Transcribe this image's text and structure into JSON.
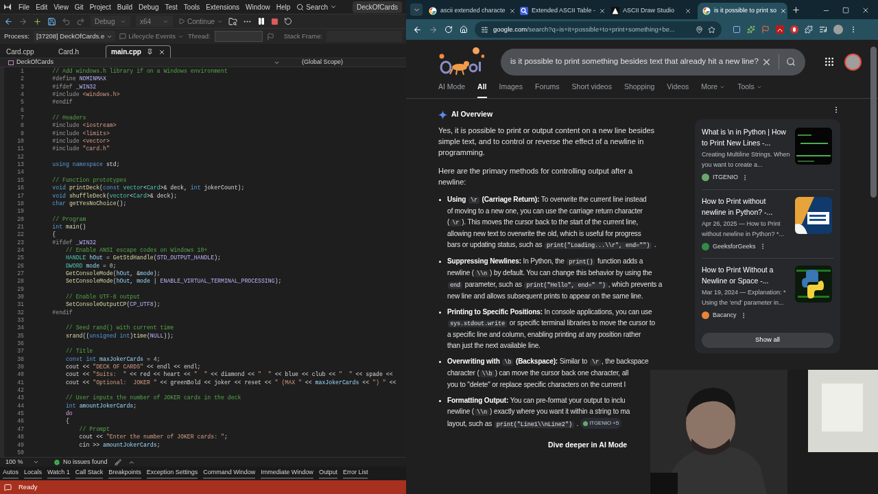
{
  "vs": {
    "menu": [
      "File",
      "Edit",
      "View",
      "Git",
      "Project",
      "Build",
      "Debug",
      "Test",
      "Tools",
      "Extensions",
      "Window",
      "Help"
    ],
    "search": "Search",
    "solution": "DeckOfCards",
    "toolbar": {
      "config": "Debug",
      "platform": "x64",
      "continue": "Continue"
    },
    "debug_bar": {
      "process_label": "Process:",
      "process": "[37208] DeckOfCards.e",
      "lifecycle": "Lifecycle Events",
      "thread_label": "Thread:",
      "stack_label": "Stack Frame:"
    },
    "doc_tabs": [
      {
        "label": "Card.cpp",
        "selected": false
      },
      {
        "label": "Card.h",
        "selected": false
      },
      {
        "label": "main.cpp",
        "selected": true
      }
    ],
    "nav": {
      "project": "DeckOfCards",
      "scope": "(Global Scope)"
    },
    "code": [
      {
        "n": "1",
        "t": [
          {
            "kind": "comment",
            "text": "        // Add windows.h library if on a Windows environment"
          }
        ]
      },
      {
        "n": "2",
        "t": [
          {
            "kind": "preproc",
            "text": "        #define "
          },
          {
            "kind": "macro",
            "text": "NOMINMAX"
          }
        ]
      },
      {
        "n": "3",
        "t": [
          {
            "kind": "preproc",
            "text": "        #ifdef "
          },
          {
            "kind": "macro",
            "text": "_WIN32"
          }
        ]
      },
      {
        "n": "4",
        "t": [
          {
            "kind": "preproc",
            "text": "        #include "
          },
          {
            "kind": "string",
            "text": "<windows.h>"
          }
        ]
      },
      {
        "n": "5",
        "t": [
          {
            "kind": "preproc",
            "text": "        #endif"
          }
        ]
      },
      {
        "n": "6"
      },
      {
        "n": "7",
        "t": [
          {
            "kind": "comment",
            "text": "        // Headers"
          }
        ]
      },
      {
        "n": "8",
        "t": [
          {
            "kind": "preproc",
            "text": "        #include "
          },
          {
            "kind": "string",
            "text": "<iostream>"
          }
        ]
      },
      {
        "n": "9",
        "t": [
          {
            "kind": "preproc",
            "text": "        #include "
          },
          {
            "kind": "string",
            "text": "<limits>"
          }
        ]
      },
      {
        "n": "10",
        "t": [
          {
            "kind": "preproc",
            "text": "        #include "
          },
          {
            "kind": "string",
            "text": "<vector>"
          }
        ]
      },
      {
        "n": "11",
        "t": [
          {
            "kind": "preproc",
            "text": "        #include "
          },
          {
            "kind": "string",
            "text": "\"card.h\""
          }
        ]
      },
      {
        "n": "12"
      },
      {
        "n": "13",
        "t": [
          {
            "kind": "keyword",
            "text": "        using namespace"
          },
          {
            "kind": "plain",
            "text": " std;"
          }
        ]
      },
      {
        "n": "14"
      },
      {
        "n": "15",
        "t": [
          {
            "kind": "comment",
            "text": "        // Function prototypes"
          }
        ]
      },
      {
        "n": "16",
        "t": [
          {
            "kind": "keyword",
            "text": "        void "
          },
          {
            "kind": "function",
            "text": "printDeck"
          },
          {
            "kind": "plain",
            "text": "("
          },
          {
            "kind": "keyword",
            "text": "const "
          },
          {
            "kind": "type",
            "text": "vector"
          },
          {
            "kind": "plain",
            "text": "<"
          },
          {
            "kind": "type",
            "text": "Card"
          },
          {
            "kind": "plain",
            "text": ">& deck, "
          },
          {
            "kind": "keyword",
            "text": "int"
          },
          {
            "kind": "plain",
            "text": " jokerCount);"
          }
        ]
      },
      {
        "n": "17",
        "t": [
          {
            "kind": "keyword",
            "text": "        void "
          },
          {
            "kind": "function",
            "text": "shuffleDeck"
          },
          {
            "kind": "plain",
            "text": "("
          },
          {
            "kind": "type",
            "text": "vector"
          },
          {
            "kind": "plain",
            "text": "<"
          },
          {
            "kind": "type",
            "text": "Card"
          },
          {
            "kind": "plain",
            "text": ">& deck);"
          }
        ]
      },
      {
        "n": "18",
        "t": [
          {
            "kind": "keyword",
            "text": "        char "
          },
          {
            "kind": "function",
            "text": "getYesNoChoice"
          },
          {
            "kind": "plain",
            "text": "();"
          }
        ]
      },
      {
        "n": "19"
      },
      {
        "n": "20",
        "t": [
          {
            "kind": "comment",
            "text": "        // Program"
          }
        ]
      },
      {
        "n": "21",
        "t": [
          {
            "kind": "keyword",
            "text": "        int "
          },
          {
            "kind": "function",
            "text": "main"
          },
          {
            "kind": "plain",
            "text": "()"
          }
        ]
      },
      {
        "n": "22",
        "t": [
          {
            "kind": "plain",
            "text": "        {"
          }
        ]
      },
      {
        "n": "23",
        "t": [
          {
            "kind": "preproc",
            "text": "        #ifdef "
          },
          {
            "kind": "macro",
            "text": "_WIN32"
          }
        ]
      },
      {
        "n": "24",
        "t": [
          {
            "kind": "comment",
            "text": "            // Enable ANSI escape codes on Windows 10+"
          }
        ]
      },
      {
        "n": "25",
        "t": [
          {
            "kind": "type",
            "text": "            HANDLE "
          },
          {
            "kind": "variable",
            "text": "hOut"
          },
          {
            "kind": "plain",
            "text": " = "
          },
          {
            "kind": "function",
            "text": "GetStdHandle"
          },
          {
            "kind": "plain",
            "text": "("
          },
          {
            "kind": "macro",
            "text": "STD_OUTPUT_HANDLE"
          },
          {
            "kind": "plain",
            "text": ");"
          }
        ]
      },
      {
        "n": "26",
        "t": [
          {
            "kind": "type",
            "text": "            DWORD "
          },
          {
            "kind": "variable",
            "text": "mode"
          },
          {
            "kind": "plain",
            "text": " = "
          },
          {
            "kind": "number",
            "text": "0"
          },
          {
            "kind": "plain",
            "text": ";"
          }
        ]
      },
      {
        "n": "27",
        "t": [
          {
            "kind": "function",
            "text": "            GetConsoleMode"
          },
          {
            "kind": "plain",
            "text": "("
          },
          {
            "kind": "variable",
            "text": "hOut"
          },
          {
            "kind": "plain",
            "text": ", &"
          },
          {
            "kind": "variable",
            "text": "mode"
          },
          {
            "kind": "plain",
            "text": ");"
          }
        ]
      },
      {
        "n": "28",
        "t": [
          {
            "kind": "function",
            "text": "            SetConsoleMode"
          },
          {
            "kind": "plain",
            "text": "("
          },
          {
            "kind": "variable",
            "text": "hOut"
          },
          {
            "kind": "plain",
            "text": ", "
          },
          {
            "kind": "variable",
            "text": "mode"
          },
          {
            "kind": "plain",
            "text": " | "
          },
          {
            "kind": "macro",
            "text": "ENABLE_VIRTUAL_TERMINAL_PROCESSING"
          },
          {
            "kind": "plain",
            "text": ");"
          }
        ]
      },
      {
        "n": "29"
      },
      {
        "n": "30",
        "t": [
          {
            "kind": "comment",
            "text": "            // Enable UTF-8 output"
          }
        ]
      },
      {
        "n": "31",
        "t": [
          {
            "kind": "function",
            "text": "            SetConsoleOutputCP"
          },
          {
            "kind": "plain",
            "text": "("
          },
          {
            "kind": "macro",
            "text": "CP_UTF8"
          },
          {
            "kind": "plain",
            "text": ");"
          }
        ]
      },
      {
        "n": "32",
        "t": [
          {
            "kind": "preproc",
            "text": "        #endif"
          }
        ]
      },
      {
        "n": "33"
      },
      {
        "n": "34",
        "t": [
          {
            "kind": "comment",
            "text": "            // Seed rand() with current time"
          }
        ]
      },
      {
        "n": "35",
        "t": [
          {
            "kind": "function",
            "text": "            srand"
          },
          {
            "kind": "plain",
            "text": "(("
          },
          {
            "kind": "keyword",
            "text": "unsigned int"
          },
          {
            "kind": "plain",
            "text": ")"
          },
          {
            "kind": "function",
            "text": "time"
          },
          {
            "kind": "plain",
            "text": "("
          },
          {
            "kind": "macro",
            "text": "NULL"
          },
          {
            "kind": "plain",
            "text": "));"
          }
        ]
      },
      {
        "n": "36"
      },
      {
        "n": "37",
        "t": [
          {
            "kind": "comment",
            "text": "            // Title"
          }
        ]
      },
      {
        "n": "38",
        "t": [
          {
            "kind": "keyword",
            "text": "            const int "
          },
          {
            "kind": "variable",
            "text": "maxJokerCards"
          },
          {
            "kind": "plain",
            "text": " = "
          },
          {
            "kind": "number",
            "text": "4"
          },
          {
            "kind": "plain",
            "text": ";"
          }
        ]
      },
      {
        "n": "39",
        "t": [
          {
            "kind": "plain",
            "text": "            cout << "
          },
          {
            "kind": "string",
            "text": "\"DECK OF CARDS\""
          },
          {
            "kind": "plain",
            "text": " << endl << endl;"
          }
        ]
      },
      {
        "n": "40",
        "t": [
          {
            "kind": "plain",
            "text": "            cout << "
          },
          {
            "kind": "string",
            "text": "\"Suits:  \""
          },
          {
            "kind": "plain",
            "text": " << red << heart << "
          },
          {
            "kind": "string",
            "text": "\"  \""
          },
          {
            "kind": "plain",
            "text": " << diamond << "
          },
          {
            "kind": "string",
            "text": "\"  \""
          },
          {
            "kind": "plain",
            "text": " << blue << club << "
          },
          {
            "kind": "string",
            "text": "\"  \""
          },
          {
            "kind": "plain",
            "text": " << spade <<"
          }
        ]
      },
      {
        "n": "41",
        "t": [
          {
            "kind": "plain",
            "text": "            cout << "
          },
          {
            "kind": "string",
            "text": "\"Optional:  JOKER \""
          },
          {
            "kind": "plain",
            "text": " << greenBold << joker << reset << "
          },
          {
            "kind": "string",
            "text": "\" (MAX \""
          },
          {
            "kind": "plain",
            "text": " << "
          },
          {
            "kind": "variable",
            "text": "maxJokerCards"
          },
          {
            "kind": "plain",
            "text": " << "
          },
          {
            "kind": "string",
            "text": "\") \""
          },
          {
            "kind": "plain",
            "text": " <<"
          }
        ]
      },
      {
        "n": "42"
      },
      {
        "n": "43",
        "t": [
          {
            "kind": "comment",
            "text": "            // User inputs the number of JOKER cards in the deck"
          }
        ]
      },
      {
        "n": "44",
        "t": [
          {
            "kind": "keyword",
            "text": "            int "
          },
          {
            "kind": "variable",
            "text": "amountJokerCards"
          },
          {
            "kind": "plain",
            "text": ";"
          }
        ]
      },
      {
        "n": "45",
        "t": [
          {
            "kind": "control",
            "text": "            do"
          }
        ]
      },
      {
        "n": "46",
        "t": [
          {
            "kind": "plain",
            "text": "            {"
          }
        ]
      },
      {
        "n": "47",
        "t": [
          {
            "kind": "comment",
            "text": "                // Prompt"
          }
        ]
      },
      {
        "n": "48",
        "t": [
          {
            "kind": "plain",
            "text": "                cout << "
          },
          {
            "kind": "string",
            "text": "\"Enter the number of JOKER cards: \""
          },
          {
            "kind": "plain",
            "text": ";"
          }
        ]
      },
      {
        "n": "49",
        "t": [
          {
            "kind": "plain",
            "text": "                cin >> "
          },
          {
            "kind": "variable",
            "text": "amountJokerCards"
          },
          {
            "kind": "plain",
            "text": ";"
          }
        ]
      },
      {
        "n": "50"
      }
    ],
    "editor_status": {
      "zoom": "100 %",
      "issues": "No issues found"
    },
    "tool_tabs": [
      "Autos",
      "Locals",
      "Watch 1",
      "Call Stack",
      "Breakpoints",
      "Exception Settings",
      "Command Window",
      "Immediate Window",
      "Output",
      "Error List"
    ],
    "status": "Ready"
  },
  "browser": {
    "tabs": [
      {
        "title": "ascii extended characte",
        "kind": "google",
        "selected": false
      },
      {
        "title": "Extended ASCII Table -",
        "kind": "magnifier",
        "selected": false
      },
      {
        "title": "ASCII Draw Studio",
        "kind": "triangle",
        "selected": false
      },
      {
        "title": "is it possible to print so",
        "kind": "google",
        "selected": true
      }
    ],
    "url_host": "google.com",
    "url_path": "/search?q=is+it+possible+to+print+something+be...",
    "query": "is it possible to print something besides text that already hit a new line?",
    "nav": [
      {
        "label": "AI Mode",
        "selected": false
      },
      {
        "label": "All",
        "selected": true
      },
      {
        "label": "Images",
        "selected": false
      },
      {
        "label": "Forums",
        "selected": false
      },
      {
        "label": "Short videos",
        "selected": false
      },
      {
        "label": "Shopping",
        "selected": false
      },
      {
        "label": "Videos",
        "selected": false
      },
      {
        "label": "More",
        "selected": false
      },
      {
        "label": "Tools",
        "selected": false
      }
    ],
    "ai": {
      "heading": "AI Overview",
      "intro": "Yes, it is possible to print or output content on a new line besides simple text, and to control or reverse the effect of a newline in programming.",
      "lead": "Here are the primary methods for controlling output after a newline:",
      "bullets": [
        {
          "lines": [
            [
              {
                "kind": "bold",
                "text": "Using "
              },
              {
                "kind": "code",
                "text": "\\r"
              },
              {
                "kind": "bold",
                "text": " (Carriage Return):"
              },
              {
                "kind": "plain",
                "text": " To overwrite the current line instead"
              }
            ],
            [
              {
                "kind": "plain",
                "text": "of moving to a new one, you can use the carriage return character"
              }
            ],
            [
              {
                "kind": "plain",
                "text": "("
              },
              {
                "kind": "code",
                "text": "\\r"
              },
              {
                "kind": "plain",
                "text": "). This moves the cursor back to the start of the current line,"
              }
            ],
            [
              {
                "kind": "plain",
                "text": "allowing new text to overwrite the old, which is useful for progress"
              }
            ],
            [
              {
                "kind": "plain",
                "text": "bars or updating status, such as "
              },
              {
                "kind": "code",
                "text": "print(\"Loading...\\\\r\", end=\"\")"
              },
              {
                "kind": "plain",
                "text": " ."
              }
            ]
          ]
        },
        {
          "lines": [
            [
              {
                "kind": "bold",
                "text": "Suppressing Newlines:"
              },
              {
                "kind": "plain",
                "text": " In Python, the "
              },
              {
                "kind": "code",
                "text": "print()"
              },
              {
                "kind": "plain",
                "text": " function adds a"
              }
            ],
            [
              {
                "kind": "plain",
                "text": "newline ("
              },
              {
                "kind": "code",
                "text": "\\\\n"
              },
              {
                "kind": "plain",
                "text": ") by default. You can change this behavior by using the"
              }
            ],
            [
              {
                "kind": "code",
                "text": "end"
              },
              {
                "kind": "plain",
                "text": " parameter, such as "
              },
              {
                "kind": "code",
                "text": "print(\"Hello\", end=\" \")"
              },
              {
                "kind": "plain",
                "text": ", which prevents a"
              }
            ],
            [
              {
                "kind": "plain",
                "text": "new line and allows subsequent prints to appear on the same line."
              }
            ]
          ]
        },
        {
          "lines": [
            [
              {
                "kind": "bold",
                "text": "Printing to Specific Positions:"
              },
              {
                "kind": "plain",
                "text": " In console applications, you can use"
              }
            ],
            [
              {
                "kind": "code",
                "text": "sys.stdout.write"
              },
              {
                "kind": "plain",
                "text": " or specific terminal libraries to move the cursor to"
              }
            ],
            [
              {
                "kind": "plain",
                "text": "a specific line and column, enabling printing at any position rather"
              }
            ],
            [
              {
                "kind": "plain",
                "text": "than just the next available line."
              }
            ]
          ]
        },
        {
          "lines": [
            [
              {
                "kind": "bold",
                "text": "Overwriting with "
              },
              {
                "kind": "code",
                "text": "\\b"
              },
              {
                "kind": "bold",
                "text": " (Backspace):"
              },
              {
                "kind": "plain",
                "text": " Similar to "
              },
              {
                "kind": "code",
                "text": "\\r"
              },
              {
                "kind": "plain",
                "text": ", the backspace"
              }
            ],
            [
              {
                "kind": "plain",
                "text": "character ("
              },
              {
                "kind": "code",
                "text": "\\\\b"
              },
              {
                "kind": "plain",
                "text": ") can move the cursor back one character, all"
              }
            ],
            [
              {
                "kind": "plain",
                "text": "you to \"delete\" or replace specific characters on the current l"
              }
            ]
          ]
        },
        {
          "lines": [
            [
              {
                "kind": "bold",
                "text": "Formatting Output:"
              },
              {
                "kind": "plain",
                "text": " You can pre-format your output to inclu"
              }
            ],
            [
              {
                "kind": "plain",
                "text": "newline ("
              },
              {
                "kind": "code",
                "text": "\\\\n"
              },
              {
                "kind": "plain",
                "text": ") exactly where you want it within a string to ma"
              }
            ],
            [
              {
                "kind": "plain",
                "text": "layout, such as "
              },
              {
                "kind": "code",
                "text": "print(\"Line1\\\\nLine2\")"
              },
              {
                "kind": "plain",
                "text": " ."
              },
              {
                "kind": "chip",
                "text": "ITGENIO +5"
              }
            ]
          ]
        }
      ],
      "dive": "Dive deeper in AI Mode"
    },
    "results": [
      {
        "title": "What is \\n in Python | How to Print New Lines -...",
        "snippet": "Creating Multiline Strings. When you want to create a...",
        "source": "ITGENIO",
        "color": "#6aa86a"
      },
      {
        "title": "How to Print without newline in Python? -...",
        "snippet": "Apr 26, 2025 — How to Print without newline in Python? *...",
        "source": "GeeksforGeeks",
        "color": "#2f8d46"
      },
      {
        "title": "How to Print Without a Newline or Space -...",
        "snippet": "Mar 19, 2024 — Explanation: * Using the 'end' parameter in...",
        "source": "Bacancy",
        "color": "#e8833a"
      }
    ],
    "show_all": "Show all"
  }
}
